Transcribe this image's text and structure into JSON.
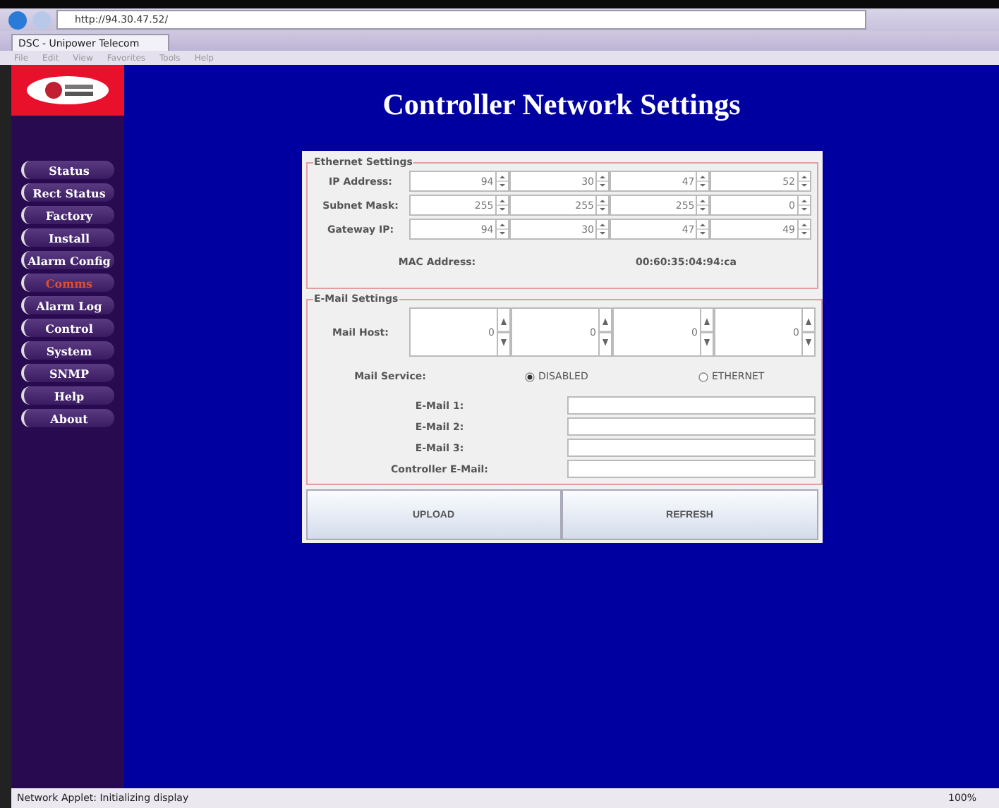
{
  "browser": {
    "address": "http://94.30.47.52/",
    "tab": "DSC - Unipower Telecom",
    "menu": [
      "File",
      "Edit",
      "View",
      "Favorites",
      "Tools",
      "Help"
    ]
  },
  "sidebar": {
    "items": [
      {
        "label": "Status",
        "selected": false
      },
      {
        "label": "Rect Status",
        "selected": false
      },
      {
        "label": "Factory",
        "selected": false
      },
      {
        "label": "Install",
        "selected": false
      },
      {
        "label": "Alarm Config",
        "selected": false
      },
      {
        "label": "Comms",
        "selected": true
      },
      {
        "label": "Alarm Log",
        "selected": false
      },
      {
        "label": "Control",
        "selected": false
      },
      {
        "label": "System",
        "selected": false
      },
      {
        "label": "SNMP",
        "selected": false
      },
      {
        "label": "Help",
        "selected": false
      },
      {
        "label": "About",
        "selected": false
      }
    ]
  },
  "title": "Controller Network Settings",
  "ethernet": {
    "legend": "Ethernet Settings",
    "rows": [
      {
        "label": "IP Address:",
        "octets": [
          "94",
          "30",
          "47",
          "52"
        ]
      },
      {
        "label": "Subnet Mask:",
        "octets": [
          "255",
          "255",
          "255",
          "0"
        ]
      },
      {
        "label": "Gateway IP:",
        "octets": [
          "94",
          "30",
          "47",
          "49"
        ]
      }
    ],
    "mac_label": "MAC Address:",
    "mac_value": "00:60:35:04:94:ca"
  },
  "email": {
    "legend": "E-Mail Settings",
    "mail_host": {
      "label": "Mail Host:",
      "octets": [
        "0",
        "0",
        "0",
        "0"
      ]
    },
    "service_label": "Mail Service:",
    "service_options": [
      {
        "label": "DISABLED",
        "selected": true
      },
      {
        "label": "ETHERNET",
        "selected": false
      }
    ],
    "fields": [
      {
        "label": "E-Mail 1:"
      },
      {
        "label": "E-Mail 2:"
      },
      {
        "label": "E-Mail 3:"
      },
      {
        "label": "Controller E-Mail:"
      }
    ]
  },
  "buttons": [
    "UPLOAD",
    "REFRESH"
  ],
  "status_bar": {
    "text": "Network Applet: Initializing display",
    "zoom": "100%"
  }
}
